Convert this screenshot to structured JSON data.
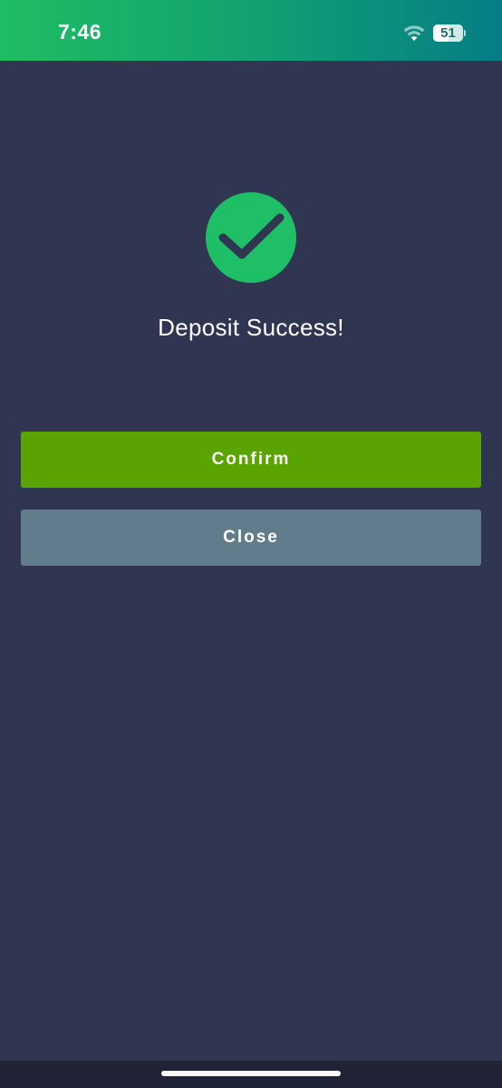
{
  "status_bar": {
    "time": "7:46",
    "battery_level": "51",
    "battery_fraction": 0.51,
    "icons": [
      "wifi-icon",
      "battery-icon"
    ]
  },
  "dialog": {
    "icon": "checkmark-circle-icon",
    "title": "Deposit Success!",
    "confirm_label": "Confirm",
    "close_label": "Close"
  },
  "colors": {
    "background": "#303552",
    "success_green": "#1fbf67",
    "confirm_button": "#5aa400",
    "close_button": "#617d8b",
    "status_gradient_start": "#1fbd63",
    "status_gradient_end": "#067d86"
  }
}
